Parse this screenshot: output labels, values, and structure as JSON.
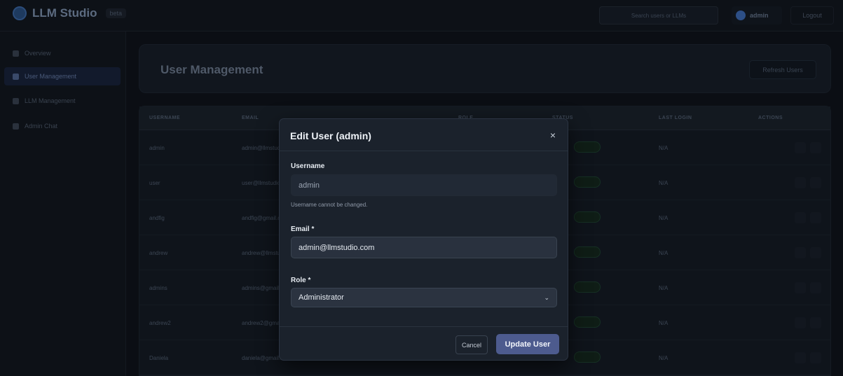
{
  "app": {
    "name": "LLM Studio",
    "version_badge": "beta"
  },
  "topbar": {
    "search_placeholder": "Search users or LLMs",
    "username": "admin",
    "logout_label": "Logout"
  },
  "sidebar": {
    "items": [
      {
        "label": "Overview",
        "icon": "home-icon"
      },
      {
        "label": "User Management",
        "icon": "users-icon"
      },
      {
        "label": "LLM Management",
        "icon": "cpu-icon"
      },
      {
        "label": "Admin Chat",
        "icon": "chat-icon"
      }
    ],
    "active_index": 1
  },
  "page": {
    "title": "User Management",
    "refresh_label": "Refresh Users"
  },
  "table": {
    "columns": [
      "USERNAME",
      "EMAIL",
      "ROLE",
      "STATUS",
      "LAST LOGIN",
      "ACTIONS"
    ],
    "rows": [
      {
        "username": "admin",
        "email": "admin@llmstudio.com",
        "last_login": "N/A"
      },
      {
        "username": "user",
        "email": "user@llmstudio.com",
        "last_login": "N/A"
      },
      {
        "username": "andfig",
        "email": "andfig@gmail.com",
        "last_login": "N/A"
      },
      {
        "username": "andrew",
        "email": "andrew@llmstudio.com",
        "last_login": "N/A"
      },
      {
        "username": "admins",
        "email": "admins@gmail.com",
        "last_login": "N/A"
      },
      {
        "username": "andrew2",
        "email": "andrew2@gmail.com",
        "last_login": "N/A"
      },
      {
        "username": "Daniela",
        "email": "daniela@gmail.com",
        "last_login": "N/A"
      }
    ]
  },
  "modal": {
    "title": "Edit User (admin)",
    "close_glyph": "×",
    "username_label": "Username",
    "username_value": "admin",
    "username_hint": "Username cannot be changed.",
    "email_label": "Email *",
    "email_value": "admin@llmstudio.com",
    "role_label": "Role *",
    "role_value": "Administrator",
    "cancel_label": "Cancel",
    "submit_label": "Update User"
  },
  "colors": {
    "background": "#0b0e14",
    "modal": "#1b222c",
    "primary_button": "#4d5b8e"
  }
}
